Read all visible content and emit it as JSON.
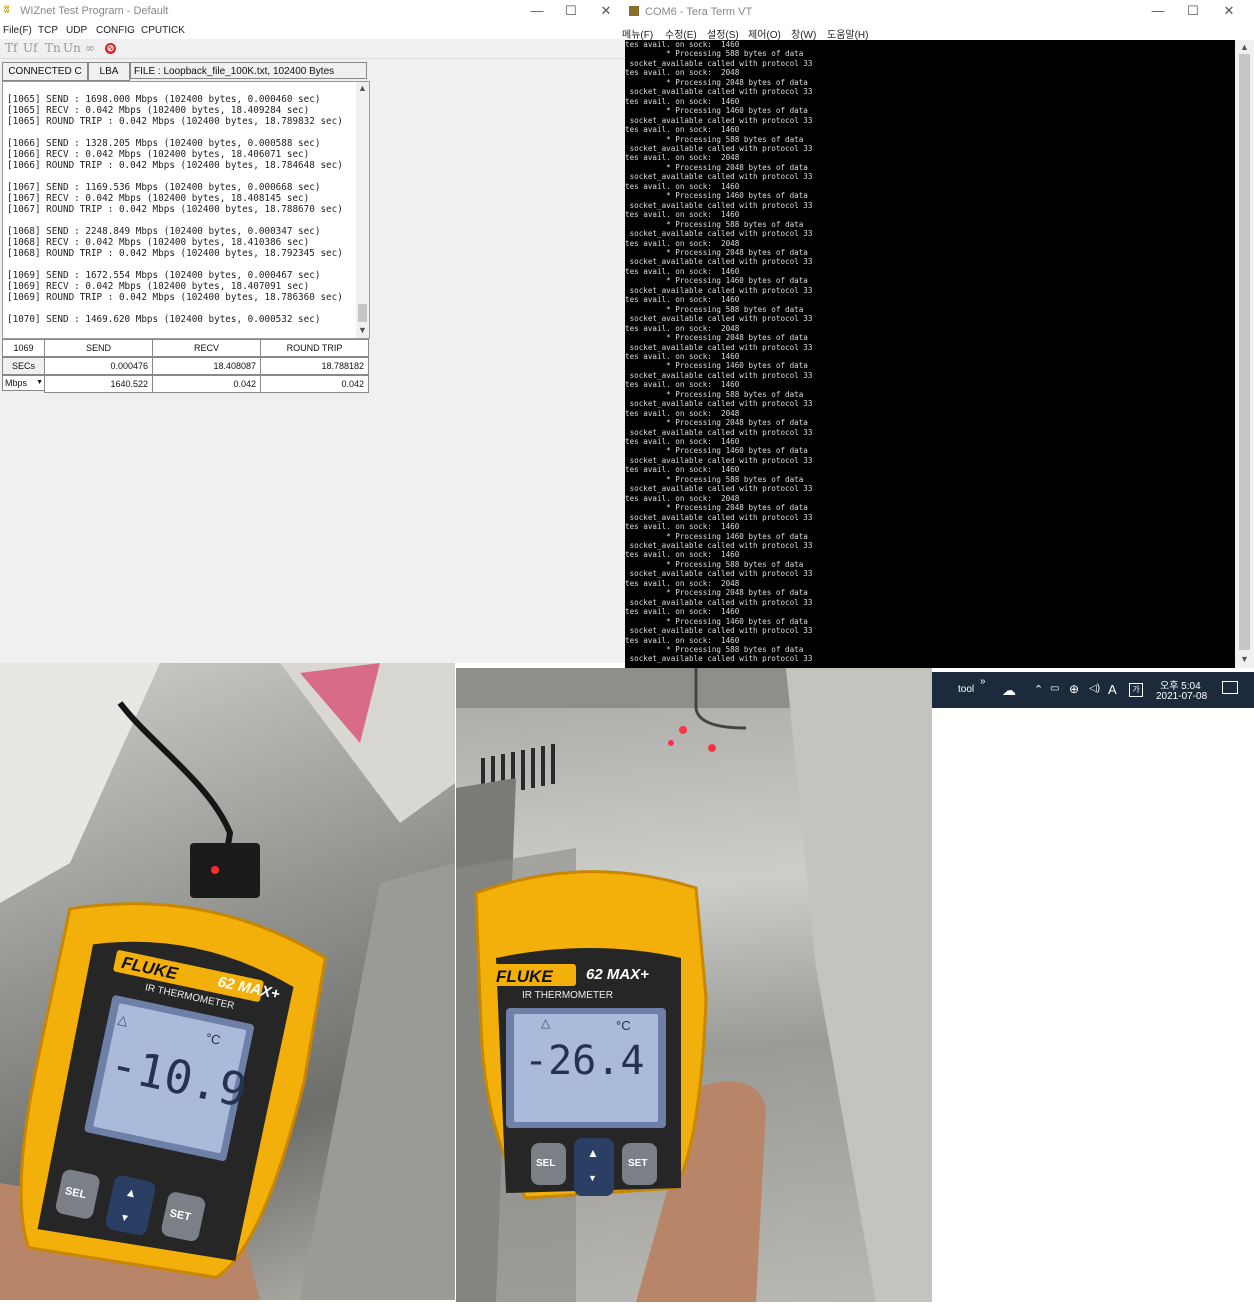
{
  "wiznet": {
    "title": "WIZnet Test Program - Default",
    "menu": [
      "File(F)",
      "TCP",
      "UDP",
      "CONFIG",
      "CPUTICK"
    ],
    "toolbar_icons": [
      "Tf",
      "Uf",
      "Tn",
      "Un",
      "∞",
      "stop"
    ],
    "status": {
      "connected": "CONNECTED C",
      "lba": "LBA",
      "file": "FILE : Loopback_file_100K.txt,  102400 Bytes"
    },
    "log_lines": [
      "[1065] SEND : 1698.000 Mbps (102400 bytes, 0.000460 sec)",
      "[1065] RECV : 0.042 Mbps (102400 bytes, 18.409284 sec)",
      "[1065] ROUND TRIP : 0.042 Mbps (102400 bytes, 18.789832 sec)",
      "",
      "[1066] SEND : 1328.205 Mbps (102400 bytes, 0.000588 sec)",
      "[1066] RECV : 0.042 Mbps (102400 bytes, 18.406071 sec)",
      "[1066] ROUND TRIP : 0.042 Mbps (102400 bytes, 18.784648 sec)",
      "",
      "[1067] SEND : 1169.536 Mbps (102400 bytes, 0.000668 sec)",
      "[1067] RECV : 0.042 Mbps (102400 bytes, 18.408145 sec)",
      "[1067] ROUND TRIP : 0.042 Mbps (102400 bytes, 18.788670 sec)",
      "",
      "[1068] SEND : 2248.849 Mbps (102400 bytes, 0.000347 sec)",
      "[1068] RECV : 0.042 Mbps (102400 bytes, 18.410386 sec)",
      "[1068] ROUND TRIP : 0.042 Mbps (102400 bytes, 18.792345 sec)",
      "",
      "[1069] SEND : 1672.554 Mbps (102400 bytes, 0.000467 sec)",
      "[1069] RECV : 0.042 Mbps (102400 bytes, 18.407091 sec)",
      "[1069] ROUND TRIP : 0.042 Mbps (102400 bytes, 18.786360 sec)",
      "",
      "[1070] SEND : 1469.620 Mbps (102400 bytes, 0.000532 sec)"
    ],
    "table": {
      "count": "1069",
      "headers": [
        "SEND",
        "RECV",
        "ROUND TRIP"
      ],
      "secs_label": "SECs",
      "secs": [
        "0.000476",
        "18.408087",
        "18.788182"
      ],
      "unit_select": "Mbps",
      "mbps": [
        "1640.522",
        "0.042",
        "0.042"
      ]
    }
  },
  "terminal": {
    "title": "COM6 - Tera Term VT",
    "menu": [
      "메뉴(F)",
      "수정(E)",
      "설정(S)",
      "제어(O)",
      "창(W)",
      "도움말(H)"
    ],
    "lines": [
      "tes avail. on sock:  1460",
      "         * Processing 588 bytes of data",
      " socket_available called with protocol 33",
      "tes avail. on sock:  2048",
      "         * Processing 2048 bytes of data",
      " socket_available called with protocol 33",
      "tes avail. on sock:  1460",
      "         * Processing 1460 bytes of data",
      " socket_available called with protocol 33",
      "tes avail. on sock:  1460",
      "         * Processing 588 bytes of data",
      " socket_available called with protocol 33",
      "tes avail. on sock:  2048",
      "         * Processing 2048 bytes of data",
      " socket_available called with protocol 33",
      "tes avail. on sock:  1460",
      "         * Processing 1460 bytes of data",
      " socket_available called with protocol 33",
      "tes avail. on sock:  1460",
      "         * Processing 588 bytes of data",
      " socket_available called with protocol 33",
      "tes avail. on sock:  2048",
      "         * Processing 2048 bytes of data",
      " socket_available called with protocol 33",
      "tes avail. on sock:  1460",
      "         * Processing 1460 bytes of data",
      " socket_available called with protocol 33",
      "tes avail. on sock:  1460",
      "         * Processing 588 bytes of data",
      " socket_available called with protocol 33",
      "tes avail. on sock:  2048",
      "         * Processing 2048 bytes of data",
      " socket_available called with protocol 33",
      "tes avail. on sock:  1460",
      "         * Processing 1460 bytes of data",
      " socket_available called with protocol 33",
      "tes avail. on sock:  1460",
      "         * Processing 588 bytes of data",
      " socket_available called with protocol 33",
      "tes avail. on sock:  2048",
      "         * Processing 2048 bytes of data",
      " socket_available called with protocol 33",
      "tes avail. on sock:  1460",
      "         * Processing 1460 bytes of data",
      " socket_available called with protocol 33",
      "tes avail. on sock:  1460",
      "         * Processing 588 bytes of data",
      " socket_available called with protocol 33",
      "tes avail. on sock:  2048",
      "         * Processing 2048 bytes of data",
      " socket_available called with protocol 33",
      "tes avail. on sock:  1460",
      "         * Processing 1460 bytes of data",
      " socket_available called with protocol 33",
      "tes avail. on sock:  1460",
      "         * Processing 588 bytes of data",
      " socket_available called with protocol 33",
      "tes avail. on sock:  2048",
      "         * Processing 2048 bytes of data",
      " socket_available called with protocol 33",
      "tes avail. on sock:  1460",
      "         * Processing 1460 bytes of data",
      " socket_available called with protocol 33",
      "tes avail. on sock:  1460",
      "         * Processing 588 bytes of data",
      " socket_available called with protocol 33"
    ]
  },
  "taskbar": {
    "tool_label": "tool",
    "overflow": "»",
    "ime": "A",
    "time": "오후 5:04",
    "date": "2021-07-08"
  },
  "photos": {
    "left": {
      "brand": "FLUKE",
      "model": "62 MAX+",
      "subtitle": "IR THERMOMETER",
      "unit": "°C",
      "reading": "-10.9",
      "buttons": [
        "SEL",
        "SET"
      ]
    },
    "right": {
      "brand": "FLUKE",
      "model": "62 MAX+",
      "subtitle": "IR THERMOMETER",
      "unit": "°C",
      "reading": "-26.4",
      "buttons": [
        "SEL",
        "SET"
      ]
    }
  }
}
